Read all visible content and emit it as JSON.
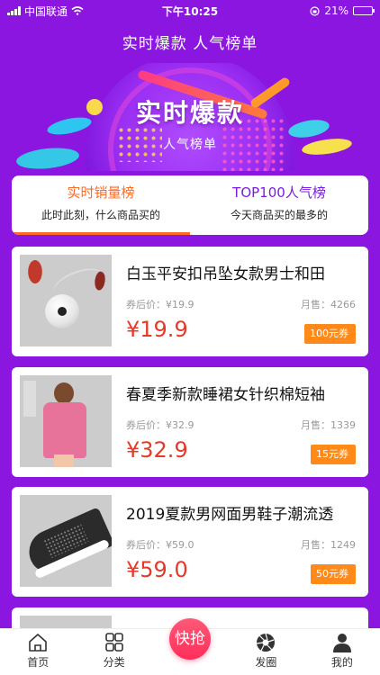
{
  "status_bar": {
    "carrier": "中国联通",
    "time": "下午10:25",
    "battery": "21%"
  },
  "nav": {
    "title": "实时爆款 人气榜单"
  },
  "banner": {
    "title": "实时爆款",
    "subtitle": "人气榜单"
  },
  "tabs": [
    {
      "title": "实时销量榜",
      "subtitle": "此时此刻，什么商品买的"
    },
    {
      "title": "TOP100人气榜",
      "subtitle": "今天商品买的最多的"
    }
  ],
  "products": [
    {
      "name": "白玉平安扣吊坠女款男士和田",
      "coupon_price_label": "券后价：¥19.9",
      "sales_label": "月售：4266",
      "price": "¥19.9",
      "coupon": "100元券"
    },
    {
      "name": "春夏季新款睡裙女针织棉短袖",
      "coupon_price_label": "券后价：¥32.9",
      "sales_label": "月售：1339",
      "price": "¥32.9",
      "coupon": "15元券"
    },
    {
      "name": "2019夏款男网面男鞋子潮流透",
      "coupon_price_label": "券后价：¥59.0",
      "sales_label": "月售：1249",
      "price": "¥59.0",
      "coupon": "50元券"
    }
  ],
  "tabbar": {
    "items": [
      {
        "label": "首页",
        "icon": "home-icon"
      },
      {
        "label": "分类",
        "icon": "grid-icon"
      },
      {
        "label": "快抢",
        "icon": "flash-sale-button"
      },
      {
        "label": "发圈",
        "icon": "aperture-icon"
      },
      {
        "label": "我的",
        "icon": "user-icon"
      }
    ]
  },
  "colors": {
    "background": "#8a16e0",
    "active_tab": "#ff6a26",
    "inactive_tab": "#7a1ce0",
    "price": "#e33a2a",
    "coupon": "#ff8a1a"
  }
}
